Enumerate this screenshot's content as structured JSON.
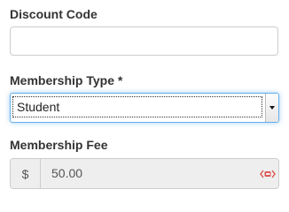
{
  "discount": {
    "label": "Discount Code",
    "value": "",
    "placeholder": ""
  },
  "membership": {
    "label": "Membership Type *",
    "selected": "Student"
  },
  "fee": {
    "label": "Membership Fee",
    "currency_symbol": "$",
    "value": "50.00"
  },
  "colors": {
    "focus_border": "#66afe9",
    "readonly_bg": "#eeeeee",
    "badge": "#d9534f"
  }
}
